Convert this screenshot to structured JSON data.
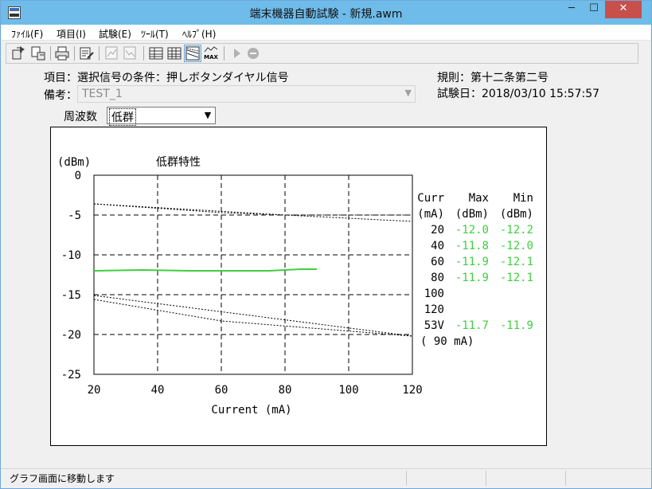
{
  "window": {
    "title": "端末機器自動試験 - 新規.awm",
    "minimize": "─",
    "maximize": "☐",
    "close": "✕"
  },
  "menu": [
    "ﾌｧｲﾙ(F)",
    "項目(I)",
    "試験(E)",
    "ﾂｰﾙ(T)",
    "ﾍﾙﾌﾟ(H)"
  ],
  "toolbar": {
    "buttons": [
      {
        "name": "open-icon",
        "enabled": true
      },
      {
        "name": "save-icon",
        "enabled": true
      },
      {
        "name": "print-icon",
        "enabled": true
      },
      {
        "name": "edit-icon",
        "enabled": true
      },
      {
        "name": "compare-icon",
        "enabled": false
      },
      {
        "name": "compare-alt-icon",
        "enabled": false
      },
      {
        "name": "table-icon",
        "enabled": true
      },
      {
        "name": "table-alt-icon",
        "enabled": true
      },
      {
        "name": "graph-icon",
        "enabled": true
      },
      {
        "name": "max-icon",
        "enabled": true,
        "text": "MAX"
      },
      {
        "name": "play-icon",
        "enabled": false
      },
      {
        "name": "stop-icon",
        "enabled": false
      }
    ]
  },
  "info": {
    "item": "項目：選択信号の条件：押しボタンダイヤル信号",
    "rule": "規則：第十二条第二号",
    "remark_label": "備考：",
    "remark_value": "TEST_1",
    "test_date": "試験日：2018/03/10 15:57:57",
    "freq_label": "周波数",
    "freq_value": "低群"
  },
  "chart_data": {
    "type": "line",
    "title": "低群特性",
    "ylabel": "(dBm)",
    "xlabel": "Current (mA)",
    "xlim": [
      20,
      120
    ],
    "ylim": [
      -25,
      0
    ],
    "xticks": [
      20,
      40,
      60,
      80,
      100,
      120
    ],
    "yticks": [
      0,
      -5,
      -10,
      -15,
      -20,
      -25
    ],
    "grid": true,
    "series": [
      {
        "style": "solid",
        "color": "#3fce3f",
        "x": [
          20,
          35,
          50,
          65,
          75,
          80,
          85,
          90
        ],
        "y": [
          -12.0,
          -11.9,
          -12.0,
          -12.0,
          -12.0,
          -11.9,
          -11.8,
          -11.8
        ]
      },
      {
        "style": "dotted",
        "color": "#000000",
        "x": [
          20,
          60,
          80,
          120
        ],
        "y": [
          -3.6,
          -4.7,
          -5.0,
          -5.8
        ]
      },
      {
        "style": "dotted",
        "color": "#000000",
        "x": [
          20,
          80,
          120
        ],
        "y": [
          -3.6,
          -5.0,
          -5.0
        ]
      },
      {
        "style": "dotted",
        "color": "#000000",
        "x": [
          20,
          120
        ],
        "y": [
          -15.1,
          -20.2
        ]
      },
      {
        "style": "dotted",
        "color": "#000000",
        "x": [
          20,
          60,
          120
        ],
        "y": [
          -15.6,
          -18.3,
          -20.2
        ]
      }
    ],
    "table": {
      "headers": [
        [
          "Curr",
          "Max",
          "Min"
        ],
        [
          "(mA)",
          "(dBm)",
          "(dBm)"
        ]
      ],
      "rows": [
        [
          "20",
          "-12.0",
          "-12.2"
        ],
        [
          "40",
          "-11.8",
          "-12.0"
        ],
        [
          "60",
          "-11.9",
          "-12.1"
        ],
        [
          "80",
          "-11.9",
          "-12.1"
        ],
        [
          "100",
          "",
          ""
        ],
        [
          "120",
          "",
          ""
        ],
        [
          "53V",
          "-11.7",
          "-11.9"
        ]
      ],
      "footer": "( 90 mA)",
      "value_color": "#3fce3f"
    }
  },
  "status": {
    "text": "グラフ画面に移動します"
  }
}
